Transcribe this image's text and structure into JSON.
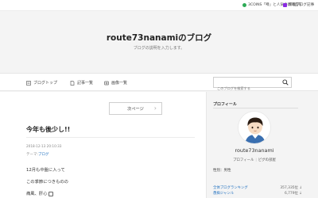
{
  "topbar": {
    "item1_label": "3COINS「噂」と人気の新商品を",
    "item2_label": "新着ブログ記事"
  },
  "blog": {
    "title": "route73nanamiのブログ",
    "description": "ブログの説明を入力します。"
  },
  "nav": {
    "items": [
      {
        "label": "ブログトップ",
        "icon": "blog-top-icon"
      },
      {
        "label": "記事一覧",
        "icon": "article-list-icon"
      },
      {
        "label": "画像一覧",
        "icon": "image-list-icon"
      }
    ],
    "search_placeholder": "このブログを検索する"
  },
  "pagination": {
    "next_label": "次ページ"
  },
  "post": {
    "title": "今年も後少し!!",
    "date": "2018-12-13 20:10:33",
    "theme_prefix": "テーマ:",
    "theme_link": "ブログ",
    "lines": [
      "12月も中盤に入って",
      "この季節につきものの",
      "痛風、肝心"
    ]
  },
  "sidebar": {
    "profile_heading": "プロフィール",
    "user_name": "route73nanami",
    "links": [
      "プロフィール",
      "ピグの部屋"
    ],
    "gender": "性別：男性",
    "rankings": [
      {
        "label": "全体ブログランキング",
        "value": "357,335位 ↓"
      },
      {
        "label": "愚痴ジャンル",
        "value": "6,779位 ↓"
      }
    ]
  },
  "colors": {
    "accent_link": "#1f6fbf",
    "topbar_dot_green": "#2eaa56",
    "background": "#f4f4f4"
  }
}
